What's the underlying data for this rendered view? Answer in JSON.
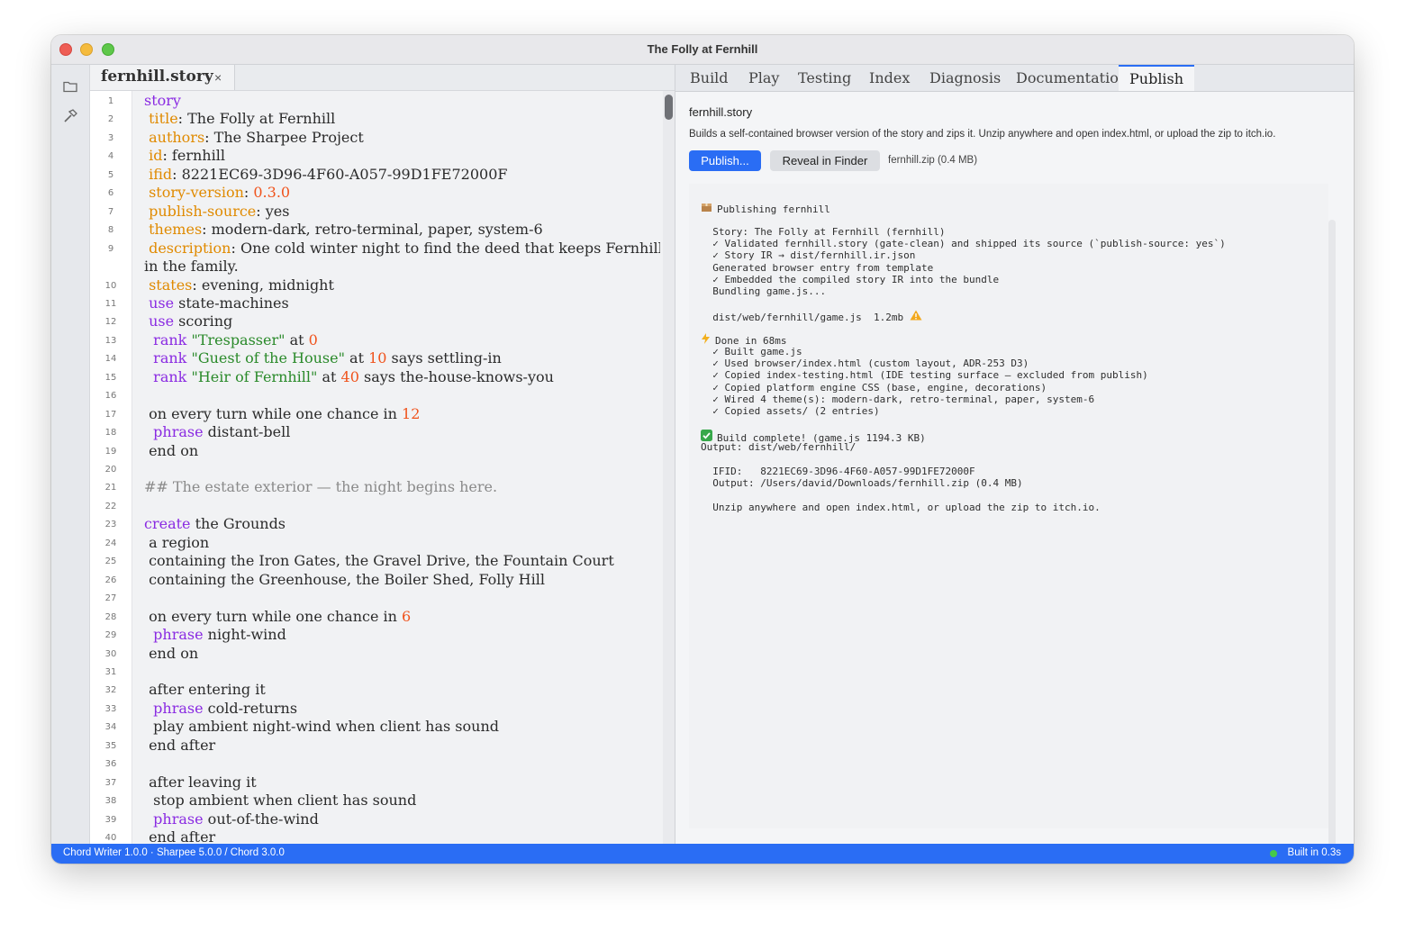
{
  "window": {
    "title": "The Folly at Fernhill"
  },
  "editor": {
    "tab_name": "fernhill.story",
    "tab_close": "×",
    "lines": [
      {
        "n": "1",
        "parts": [
          [
            "k-kw",
            "story"
          ]
        ]
      },
      {
        "n": "2",
        "parts": [
          [
            "k-plain",
            " "
          ],
          [
            "k-key",
            "title"
          ],
          [
            "k-plain",
            ": The Folly at Fernhill"
          ]
        ]
      },
      {
        "n": "3",
        "parts": [
          [
            "k-plain",
            " "
          ],
          [
            "k-key",
            "authors"
          ],
          [
            "k-plain",
            ": The Sharpee Project"
          ]
        ]
      },
      {
        "n": "4",
        "parts": [
          [
            "k-plain",
            " "
          ],
          [
            "k-key",
            "id"
          ],
          [
            "k-plain",
            ": fernhill"
          ]
        ]
      },
      {
        "n": "5",
        "parts": [
          [
            "k-plain",
            " "
          ],
          [
            "k-key",
            "ifid"
          ],
          [
            "k-plain",
            ": 8221EC69-3D96-4F60-A057-99D1FE72000F"
          ]
        ]
      },
      {
        "n": "6",
        "parts": [
          [
            "k-plain",
            " "
          ],
          [
            "k-key",
            "story-version"
          ],
          [
            "k-plain",
            ": "
          ],
          [
            "k-num",
            "0.3.0"
          ]
        ]
      },
      {
        "n": "7",
        "parts": [
          [
            "k-plain",
            " "
          ],
          [
            "k-key",
            "publish-source"
          ],
          [
            "k-plain",
            ": yes"
          ]
        ]
      },
      {
        "n": "8",
        "parts": [
          [
            "k-plain",
            " "
          ],
          [
            "k-key",
            "themes"
          ],
          [
            "k-plain",
            ": modern-dark, retro-terminal, paper, system-6"
          ]
        ]
      },
      {
        "n": "9",
        "parts": [
          [
            "k-plain",
            " "
          ],
          [
            "k-key",
            "description"
          ],
          [
            "k-plain",
            ": One cold winter night to find the deed that keeps Fernhill"
          ]
        ]
      },
      {
        "n": "",
        "parts": [
          [
            "k-plain",
            "in the family."
          ]
        ]
      },
      {
        "n": "10",
        "parts": [
          [
            "k-plain",
            " "
          ],
          [
            "k-key",
            "states"
          ],
          [
            "k-plain",
            ": evening, midnight"
          ]
        ]
      },
      {
        "n": "11",
        "parts": [
          [
            "k-plain",
            " "
          ],
          [
            "k-kw",
            "use"
          ],
          [
            "k-plain",
            " state-machines"
          ]
        ]
      },
      {
        "n": "12",
        "parts": [
          [
            "k-plain",
            " "
          ],
          [
            "k-kw",
            "use"
          ],
          [
            "k-plain",
            " scoring"
          ]
        ]
      },
      {
        "n": "13",
        "parts": [
          [
            "k-plain",
            "  "
          ],
          [
            "k-kw",
            "rank"
          ],
          [
            "k-plain",
            " "
          ],
          [
            "k-str",
            "\"Trespasser\""
          ],
          [
            "k-plain",
            " at "
          ],
          [
            "k-num",
            "0"
          ]
        ]
      },
      {
        "n": "14",
        "parts": [
          [
            "k-plain",
            "  "
          ],
          [
            "k-kw",
            "rank"
          ],
          [
            "k-plain",
            " "
          ],
          [
            "k-str",
            "\"Guest of the House\""
          ],
          [
            "k-plain",
            " at "
          ],
          [
            "k-num",
            "10"
          ],
          [
            "k-plain",
            " says settling-in"
          ]
        ]
      },
      {
        "n": "15",
        "parts": [
          [
            "k-plain",
            "  "
          ],
          [
            "k-kw",
            "rank"
          ],
          [
            "k-plain",
            " "
          ],
          [
            "k-str",
            "\"Heir of Fernhill\""
          ],
          [
            "k-plain",
            " at "
          ],
          [
            "k-num",
            "40"
          ],
          [
            "k-plain",
            " says the-house-knows-you"
          ]
        ]
      },
      {
        "n": "16",
        "parts": []
      },
      {
        "n": "17",
        "parts": [
          [
            "k-plain",
            " on every turn while one chance in "
          ],
          [
            "k-num",
            "12"
          ]
        ]
      },
      {
        "n": "18",
        "parts": [
          [
            "k-plain",
            "  "
          ],
          [
            "k-kw",
            "phrase"
          ],
          [
            "k-plain",
            " distant-bell"
          ]
        ]
      },
      {
        "n": "19",
        "parts": [
          [
            "k-plain",
            " end on"
          ]
        ]
      },
      {
        "n": "20",
        "parts": []
      },
      {
        "n": "21",
        "parts": [
          [
            "k-com",
            "## The estate exterior — the night begins here."
          ]
        ]
      },
      {
        "n": "22",
        "parts": []
      },
      {
        "n": "23",
        "parts": [
          [
            "k-kw",
            "create"
          ],
          [
            "k-plain",
            " the Grounds"
          ]
        ]
      },
      {
        "n": "24",
        "parts": [
          [
            "k-plain",
            " a region"
          ]
        ]
      },
      {
        "n": "25",
        "parts": [
          [
            "k-plain",
            " containing the Iron Gates, the Gravel Drive, the Fountain Court"
          ]
        ]
      },
      {
        "n": "26",
        "parts": [
          [
            "k-plain",
            " containing the Greenhouse, the Boiler Shed, Folly Hill"
          ]
        ]
      },
      {
        "n": "27",
        "parts": []
      },
      {
        "n": "28",
        "parts": [
          [
            "k-plain",
            " on every turn while one chance in "
          ],
          [
            "k-num",
            "6"
          ]
        ]
      },
      {
        "n": "29",
        "parts": [
          [
            "k-plain",
            "  "
          ],
          [
            "k-kw",
            "phrase"
          ],
          [
            "k-plain",
            " night-wind"
          ]
        ]
      },
      {
        "n": "30",
        "parts": [
          [
            "k-plain",
            " end on"
          ]
        ]
      },
      {
        "n": "31",
        "parts": []
      },
      {
        "n": "32",
        "parts": [
          [
            "k-plain",
            " after entering it"
          ]
        ]
      },
      {
        "n": "33",
        "parts": [
          [
            "k-plain",
            "  "
          ],
          [
            "k-kw",
            "phrase"
          ],
          [
            "k-plain",
            " cold-returns"
          ]
        ]
      },
      {
        "n": "34",
        "parts": [
          [
            "k-plain",
            "  play ambient night-wind when client has sound"
          ]
        ]
      },
      {
        "n": "35",
        "parts": [
          [
            "k-plain",
            " end after"
          ]
        ]
      },
      {
        "n": "36",
        "parts": []
      },
      {
        "n": "37",
        "parts": [
          [
            "k-plain",
            " after leaving it"
          ]
        ]
      },
      {
        "n": "38",
        "parts": [
          [
            "k-plain",
            "  stop ambient when client has sound"
          ]
        ]
      },
      {
        "n": "39",
        "parts": [
          [
            "k-plain",
            "  "
          ],
          [
            "k-kw",
            "phrase"
          ],
          [
            "k-plain",
            " out-of-the-wind"
          ]
        ]
      },
      {
        "n": "40",
        "parts": [
          [
            "k-plain",
            " end after"
          ]
        ]
      }
    ]
  },
  "panel": {
    "tabs": [
      "Build",
      "Play",
      "Testing",
      "Index",
      "Diagnosis",
      "Documentation",
      "Publish"
    ],
    "active_tab": "Publish",
    "file": "fernhill.story",
    "description": "Builds a self-contained browser version of the story and zips it. Unzip anywhere and open index.html, or upload the zip to itch.io.",
    "publish_button": "Publish...",
    "reveal_button": "Reveal in Finder",
    "zip_info": "fernhill.zip (0.4 MB)",
    "log": [
      {
        "icon": "package-icon",
        "text": "Publishing fernhill"
      },
      {
        "icon": "",
        "text": ""
      },
      {
        "icon": "",
        "text": "  Story: The Folly at Fernhill (fernhill)"
      },
      {
        "icon": "",
        "text": "  ✓ Validated fernhill.story (gate-clean) and shipped its source (`publish-source: yes`)"
      },
      {
        "icon": "",
        "text": "  ✓ Story IR → dist/fernhill.ir.json"
      },
      {
        "icon": "",
        "text": "  Generated browser entry from template"
      },
      {
        "icon": "",
        "text": "  ✓ Embedded the compiled story IR into the bundle"
      },
      {
        "icon": "",
        "text": "  Bundling game.js..."
      },
      {
        "icon": "",
        "text": ""
      },
      {
        "icon": "",
        "text": "  dist/web/fernhill/game.js  1.2mb ",
        "tail_icon": "warning-icon"
      },
      {
        "icon": "",
        "text": ""
      },
      {
        "icon": "lightning-icon",
        "text": "Done in 68ms"
      },
      {
        "icon": "",
        "text": "  ✓ Built game.js"
      },
      {
        "icon": "",
        "text": "  ✓ Used browser/index.html (custom layout, ADR-253 D3)"
      },
      {
        "icon": "",
        "text": "  ✓ Copied index-testing.html (IDE testing surface — excluded from publish)"
      },
      {
        "icon": "",
        "text": "  ✓ Copied platform engine CSS (base, engine, decorations)"
      },
      {
        "icon": "",
        "text": "  ✓ Wired 4 theme(s): modern-dark, retro-terminal, paper, system-6"
      },
      {
        "icon": "",
        "text": "  ✓ Copied assets/ (2 entries)"
      },
      {
        "icon": "",
        "text": ""
      },
      {
        "icon": "check-icon",
        "text": "Build complete! (game.js 1194.3 KB)"
      },
      {
        "icon": "",
        "text": "Output: dist/web/fernhill/"
      },
      {
        "icon": "",
        "text": ""
      },
      {
        "icon": "",
        "text": "  IFID:   8221EC69-3D96-4F60-A057-99D1FE72000F"
      },
      {
        "icon": "",
        "text": "  Output: /Users/david/Downloads/fernhill.zip (0.4 MB)"
      },
      {
        "icon": "",
        "text": ""
      },
      {
        "icon": "",
        "text": "  Unzip anywhere and open index.html, or upload the zip to itch.io."
      }
    ]
  },
  "statusbar": {
    "left": "Chord Writer 1.0.0 · Sharpee 5.0.0 / Chord 3.0.0",
    "right": "Built in 0.3s"
  },
  "colors": {
    "accent": "#2a6df4",
    "keyword": "#8a2be2",
    "key": "#e08a00",
    "number": "#f0531c",
    "string": "#2a8a2a",
    "comment": "#8a8a8a",
    "status_ok": "#45c94a"
  },
  "icons": {
    "rail": [
      "folder-icon",
      "hammer-icon"
    ]
  }
}
